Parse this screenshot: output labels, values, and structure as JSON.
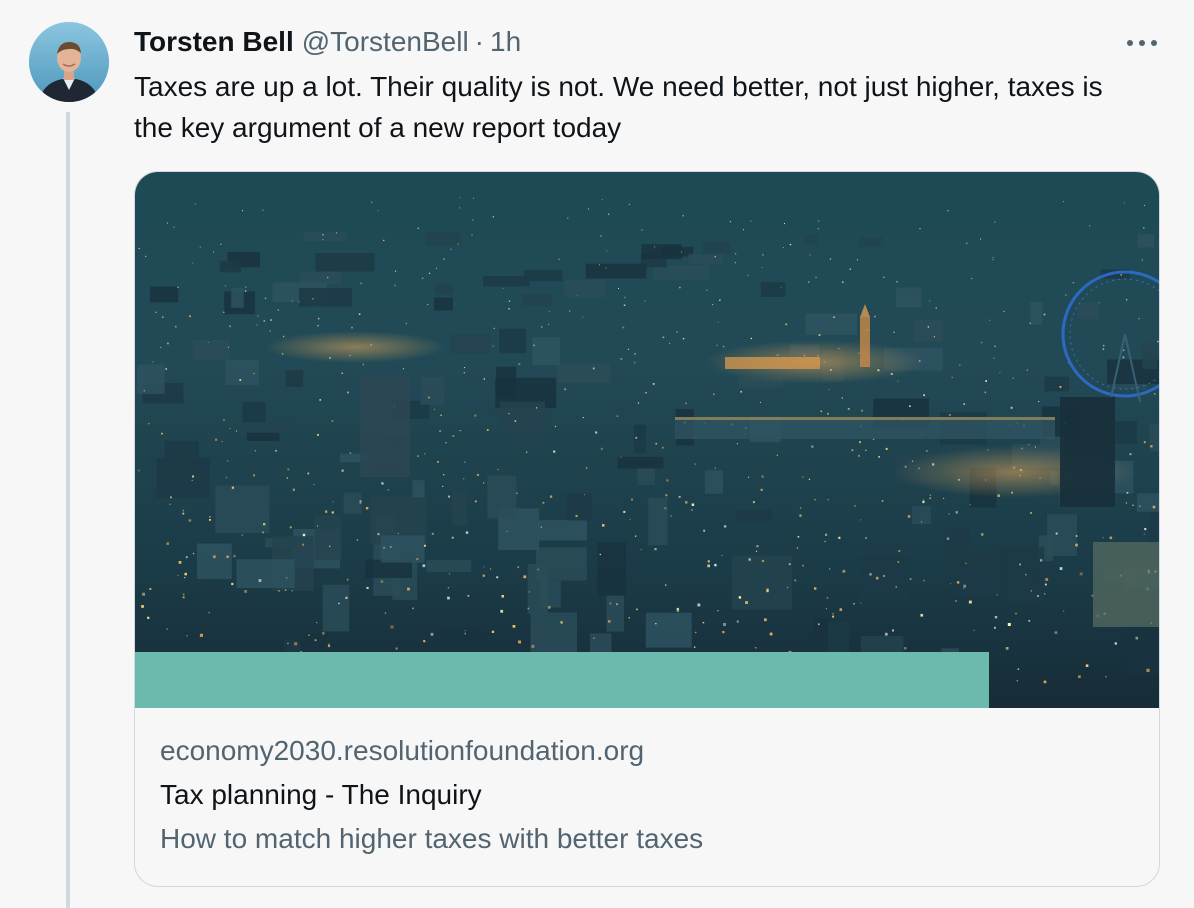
{
  "tweet": {
    "author": {
      "display_name": "Torsten Bell",
      "handle": "@TorstenBell",
      "avatar_icon": "user-avatar-photo"
    },
    "separator": "·",
    "timestamp": "1h",
    "more_icon": "more-horizontal-icon",
    "text": "Taxes are up a lot. Their quality is not. We need better, not just higher, taxes is the key argument of a new report today"
  },
  "link_card": {
    "image_icon": "city-night-aerial-image",
    "domain": "economy2030.resolutionfoundation.org",
    "title": "Tax planning - The Inquiry",
    "description": "How to match higher taxes with better taxes",
    "accent_color": "#6cbaad"
  },
  "colors": {
    "background": "#f7f7f7",
    "text_primary": "#0f1419",
    "text_secondary": "#536471",
    "border": "#cfd9de"
  }
}
